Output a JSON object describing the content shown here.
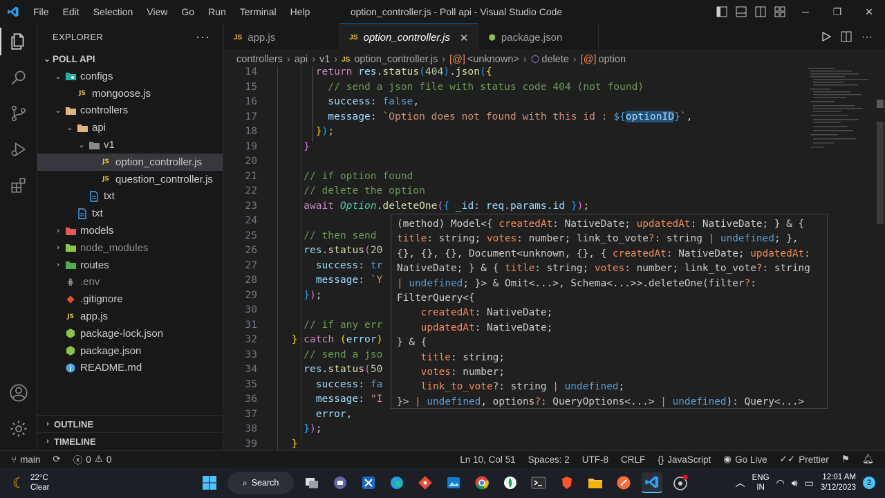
{
  "window": {
    "title": "option_controller.js - Poll api - Visual Studio Code"
  },
  "menu": [
    "File",
    "Edit",
    "Selection",
    "View",
    "Go",
    "Run",
    "Terminal",
    "Help"
  ],
  "explorer": {
    "header": "EXPLORER",
    "root": "POLL API",
    "items": [
      {
        "label": "configs",
        "indent": 0,
        "type": "folder",
        "chev": "v",
        "icon": "config-folder"
      },
      {
        "label": "mongoose.js",
        "indent": 1,
        "type": "file",
        "icon": "js"
      },
      {
        "label": "controllers",
        "indent": 0,
        "type": "folder",
        "chev": "v",
        "icon": "folder"
      },
      {
        "label": "api",
        "indent": 1,
        "type": "folder",
        "chev": "v",
        "icon": "folder"
      },
      {
        "label": "v1",
        "indent": 2,
        "type": "folder",
        "chev": "v",
        "icon": "folder-plain"
      },
      {
        "label": "option_controller.js",
        "indent": 3,
        "type": "file",
        "icon": "js",
        "selected": true
      },
      {
        "label": "question_controller.js",
        "indent": 3,
        "type": "file",
        "icon": "js"
      },
      {
        "label": "txt",
        "indent": 2,
        "type": "file",
        "icon": "txt"
      },
      {
        "label": "txt",
        "indent": 1,
        "type": "file",
        "icon": "txt"
      },
      {
        "label": "models",
        "indent": 0,
        "type": "folder",
        "chev": ">",
        "icon": "models-folder"
      },
      {
        "label": "node_modules",
        "indent": 0,
        "type": "folder",
        "chev": ">",
        "icon": "node-folder",
        "dim": true
      },
      {
        "label": "routes",
        "indent": 0,
        "type": "folder",
        "chev": ">",
        "icon": "routes-folder"
      },
      {
        "label": ".env",
        "indent": 0,
        "type": "file",
        "icon": "env",
        "dim": true
      },
      {
        "label": ".gitignore",
        "indent": 0,
        "type": "file",
        "icon": "git"
      },
      {
        "label": "app.js",
        "indent": 0,
        "type": "file",
        "icon": "js"
      },
      {
        "label": "package-lock.json",
        "indent": 0,
        "type": "file",
        "icon": "node"
      },
      {
        "label": "package.json",
        "indent": 0,
        "type": "file",
        "icon": "node"
      },
      {
        "label": "README.md",
        "indent": 0,
        "type": "file",
        "icon": "info"
      }
    ],
    "outline": "OUTLINE",
    "timeline": "TIMELINE"
  },
  "tabs": [
    {
      "label": "app.js",
      "active": false
    },
    {
      "label": "option_controller.js",
      "active": true
    },
    {
      "label": "package.json",
      "active": false
    }
  ],
  "breadcrumbs": [
    "controllers",
    "api",
    "v1",
    "option_controller.js",
    "<unknown>",
    "delete",
    "option"
  ],
  "code_lines": [
    {
      "n": "14",
      "html": "      <span class='kw'>return</span> <span class='var'>res</span>.<span class='fn'>status</span><span class='br3'>(</span><span class='num'>404</span><span class='br3'>)</span>.<span class='fn'>json</span><span class='br3'>(</span><span class='br1'>{</span>"
    },
    {
      "n": "15",
      "html": "        <span class='cm'>// send a json file with status code 404 (not found)</span>"
    },
    {
      "n": "16",
      "html": "        <span class='var'>success</span>: <span class='bool'>false</span>,"
    },
    {
      "n": "17",
      "html": "        <span class='var'>message</span>: <span class='str'>`Option does not found with this id : </span><span class='tpl'>${</span><span class='var' style='background:#264f78'>optionID</span><span class='tpl'>}</span><span class='str'>`</span>,"
    },
    {
      "n": "18",
      "html": "      <span class='br1'>}</span><span class='br3'>)</span>;"
    },
    {
      "n": "19",
      "html": "    <span class='br2'>}</span>"
    },
    {
      "n": "20",
      "html": ""
    },
    {
      "n": "21",
      "html": "    <span class='cm'>// if option found</span>"
    },
    {
      "n": "22",
      "html": "    <span class='cm'>// delete the option</span>"
    },
    {
      "n": "23",
      "html": "    <span class='kw'>await</span> <span class='cls' style='font-style:italic'>Option</span>.<span class='fn'>deleteOne</span><span class='br2'>(</span><span class='br3'>{</span> <span class='var'>_id</span>: <span class='var'>req</span>.<span class='var'>params</span>.<span class='var'>id</span> <span class='br3'>}</span><span class='br2'>)</span>;"
    },
    {
      "n": "24",
      "html": ""
    },
    {
      "n": "25",
      "html": "    <span class='cm'>// then send</span>"
    },
    {
      "n": "26",
      "html": "    <span class='var'>res</span>.<span class='fn'>status</span><span class='br2'>(</span><span class='num'>20</span>"
    },
    {
      "n": "27",
      "html": "      <span class='var'>success</span>: <span class='bool'>tr</span>"
    },
    {
      "n": "28",
      "html": "      <span class='var'>message</span>: <span class='str'>`Y</span>"
    },
    {
      "n": "29",
      "html": "    <span class='br3'>}</span><span class='br2'>)</span>;"
    },
    {
      "n": "30",
      "html": ""
    },
    {
      "n": "31",
      "html": "    <span class='cm'>// if any err</span>"
    },
    {
      "n": "32",
      "html": "  <span class='br1'>}</span> <span class='kw'>catch</span> <span class='br1'>(</span><span class='var'>error</span><span class='br1'>)</span>"
    },
    {
      "n": "33",
      "html": "    <span class='cm'>// send a jso</span>"
    },
    {
      "n": "34",
      "html": "    <span class='var'>res</span>.<span class='fn'>status</span><span class='br2'>(</span><span class='num'>50</span>"
    },
    {
      "n": "35",
      "html": "      <span class='var'>success</span>: <span class='bool'>fa</span>"
    },
    {
      "n": "36",
      "html": "      <span class='var'>message</span>: <span class='str'>\"I</span>"
    },
    {
      "n": "37",
      "html": "      <span class='var'>error</span>,"
    },
    {
      "n": "38",
      "html": "    <span class='br3'>}</span><span class='br2'>)</span>;"
    },
    {
      "n": "39",
      "html": "  <span class='br1'>}</span>"
    }
  ],
  "hover_html": "(method) Model&lt;{ <span style='color:#f28b54'>createdAt</span>: NativeDate; <span style='color:#f28b54'>updatedAt</span>: NativeDate; } &amp; {\n<span style='color:#f28b54'>title</span>: string; <span style='color:#f28b54'>votes</span>: number; link_to_vote<span style='color:#f28b54'>?</span>: string <span style='color:#f28b54'>|</span> <span style='color:#569cd6'>undefined</span>; },\n{}, {}, {}, Document&lt;unknown, {}, { <span style='color:#f28b54'>createdAt</span>: NativeDate; <span style='color:#f28b54'>updatedAt</span>:\nNativeDate; } &amp; { <span style='color:#f28b54'>title</span>: string; <span style='color:#f28b54'>votes</span>: number; link_to_vote<span style='color:#f28b54'>?</span>: string\n<span style='color:#f28b54'>|</span> <span style='color:#569cd6'>undefined</span>; }&gt; &amp; Omit&lt;...&gt;, Schema&lt;...&gt;&gt;.deleteOne(filter<span style='color:#f28b54'>?</span>:\nFilterQuery&lt;{\n    <span style='color:#f28b54'>createdAt</span>: NativeDate;\n    <span style='color:#f28b54'>updatedAt</span>: NativeDate;\n} &amp; {\n    <span style='color:#f28b54'>title</span>: string;\n    <span style='color:#f28b54'>votes</span>: number;\n    <span style='color:#f28b54'>link_to_vote</span>?: string <span style='color:#f28b54'>|</span> <span style='color:#569cd6'>undefined</span>;\n}&gt; <span style='color:#f28b54'>|</span> <span style='color:#569cd6'>undefined</span>, options<span style='color:#f28b54'>?</span>: QueryOptions&lt;...&gt; <span style='color:#f28b54'>|</span> <span style='color:#569cd6'>undefined</span>): Query&lt;...&gt;",
  "status": {
    "branch": "main",
    "errors": "0",
    "warnings": "0",
    "position": "Ln 10, Col 51",
    "spaces": "Spaces: 2",
    "encoding": "UTF-8",
    "eol": "CRLF",
    "language": "JavaScript",
    "golive": "Go Live",
    "prettier": "Prettier"
  },
  "taskbar": {
    "temp": "22°C",
    "weather": "Clear",
    "search": "Search",
    "lang1": "ENG",
    "lang2": "IN",
    "time": "12:01 AM",
    "date": "3/12/2023",
    "notif": "2"
  },
  "colors": {
    "accent": "#0078d4",
    "js": "#e8c53a",
    "folder": "#dcb67a"
  }
}
